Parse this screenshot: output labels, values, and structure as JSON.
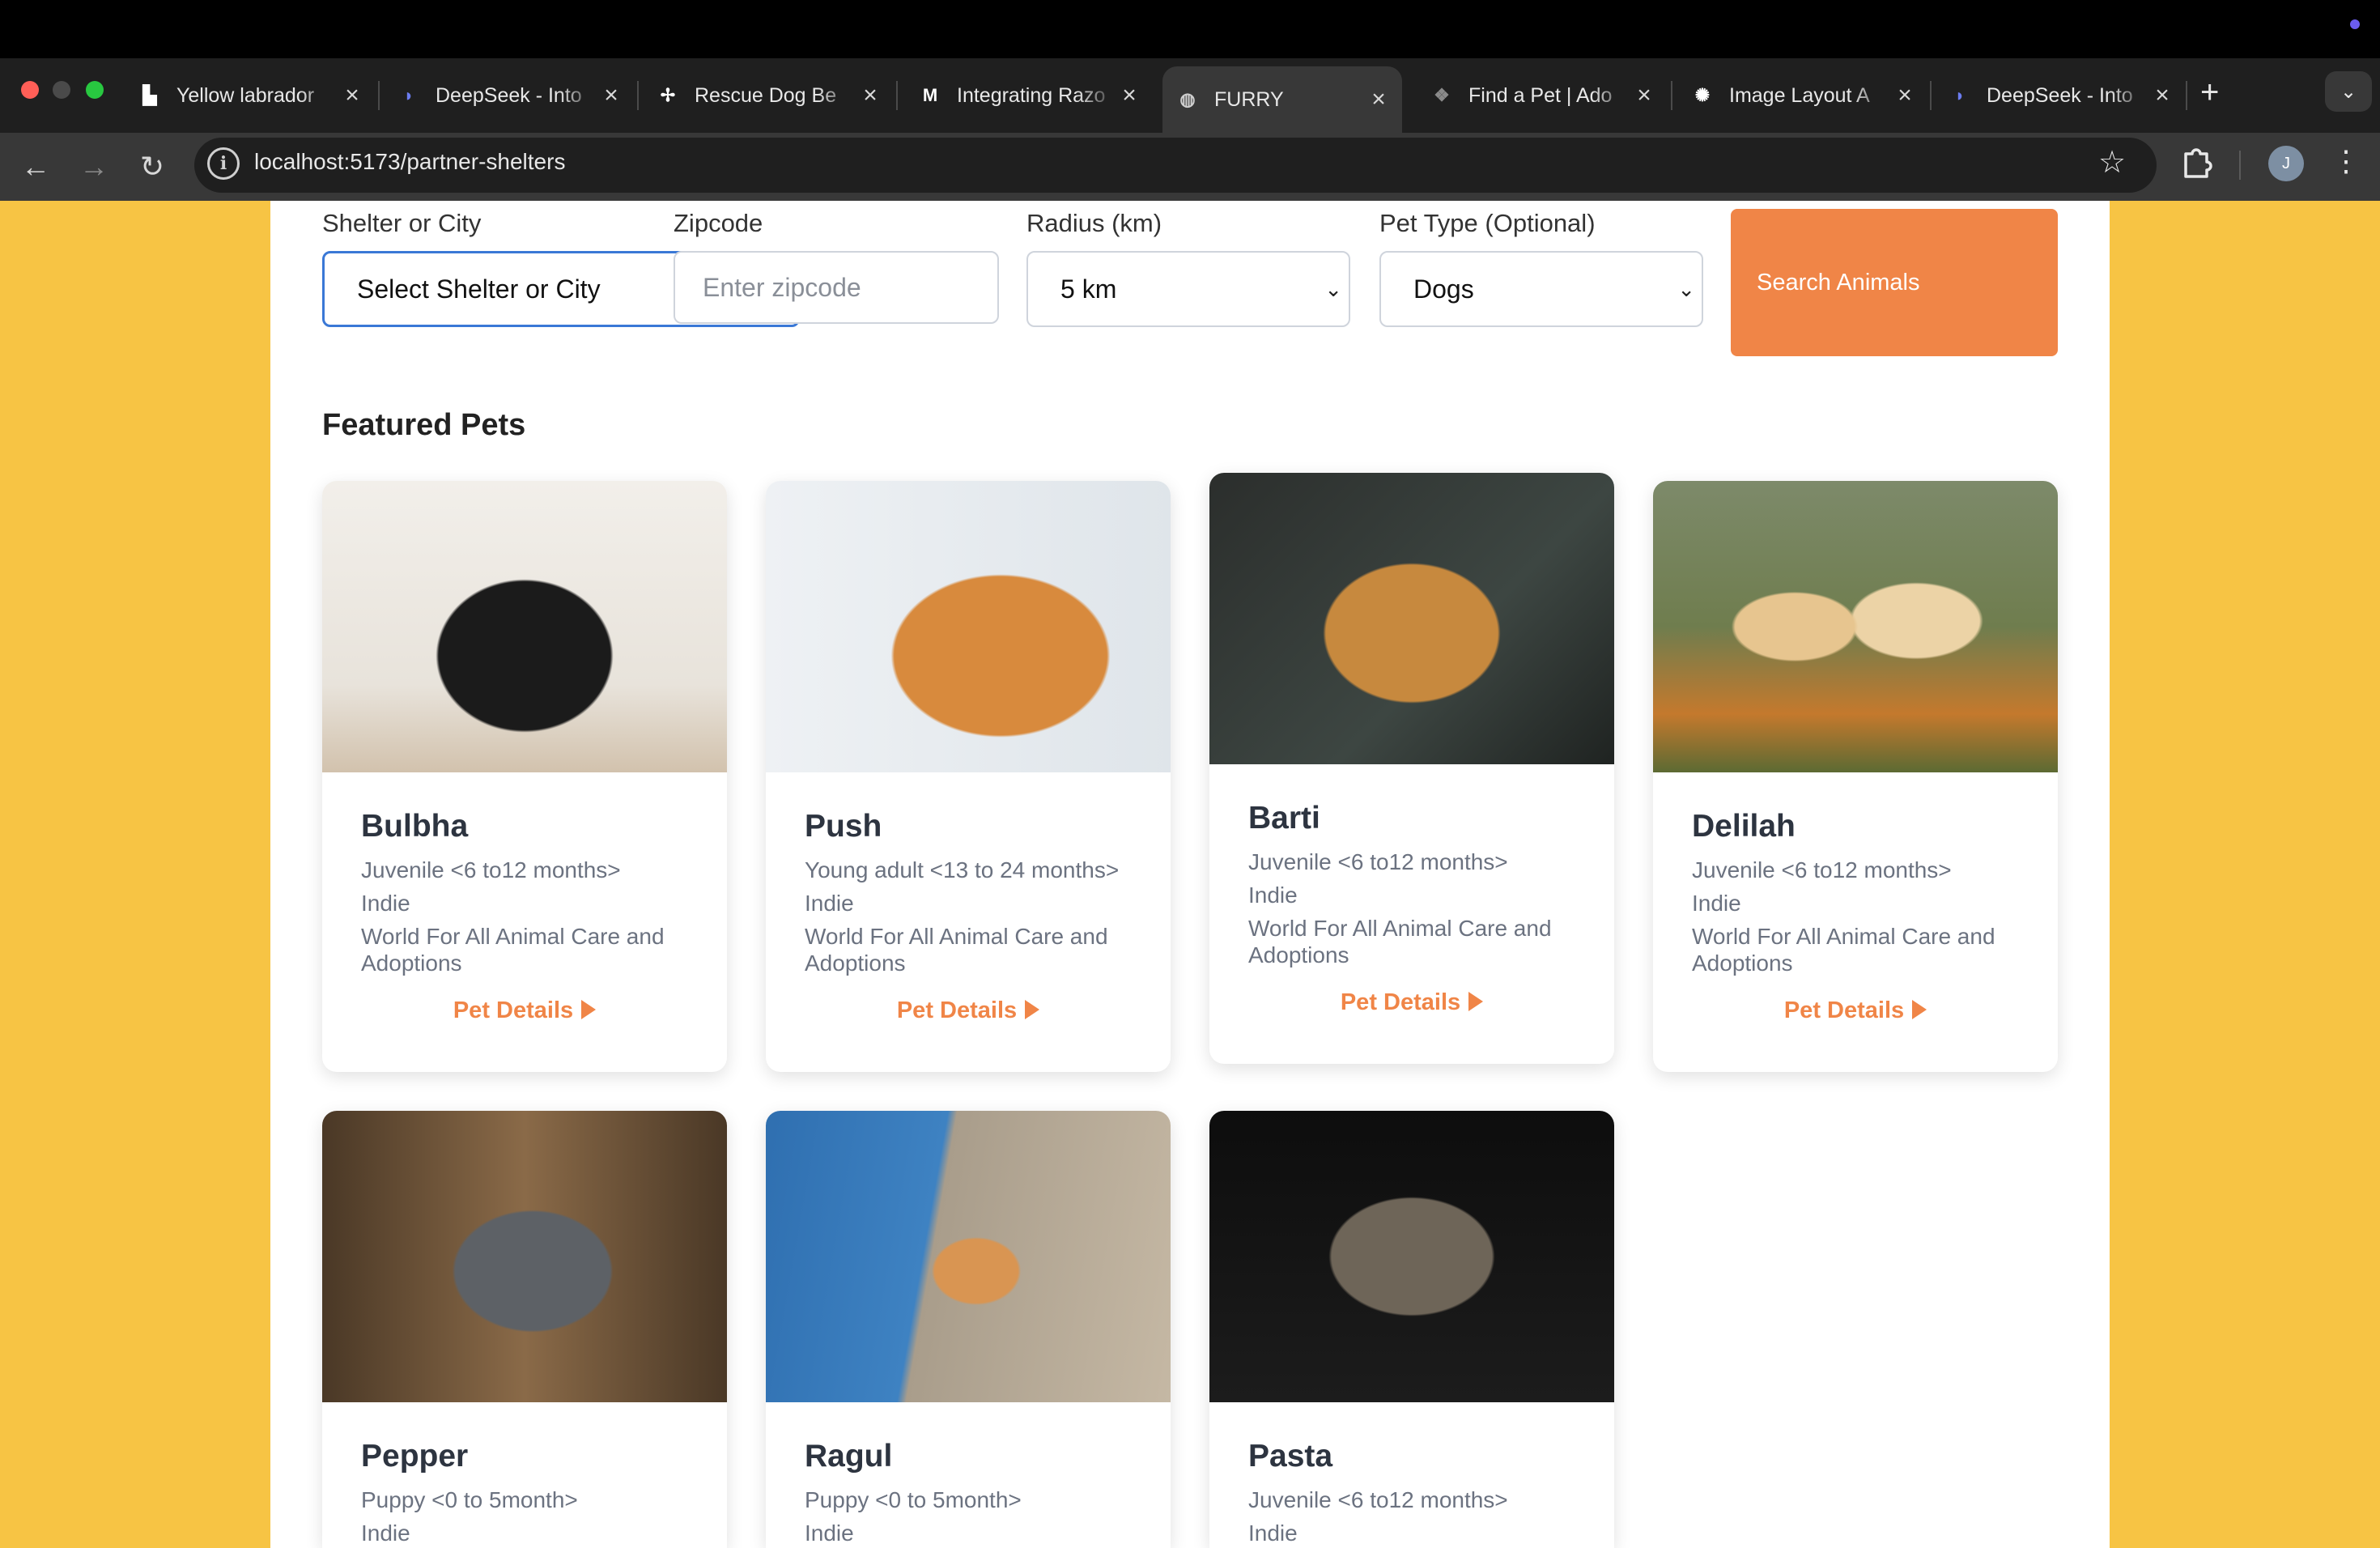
{
  "browser": {
    "tabs": [
      {
        "title": "Yellow labrador",
        "icon": "unsplash-icon"
      },
      {
        "title": "DeepSeek - Into",
        "icon": "deepseek-icon"
      },
      {
        "title": "Rescue Dog Be",
        "icon": "rescue-icon"
      },
      {
        "title": "Integrating Razo",
        "icon": "medium-icon"
      },
      {
        "title": "FURRY",
        "icon": "globe-icon",
        "active": true
      },
      {
        "title": "Find a Pet | Ado",
        "icon": "paw-icon"
      },
      {
        "title": "Image Layout A",
        "icon": "openai-icon"
      },
      {
        "title": "DeepSeek - Into",
        "icon": "deepseek-icon"
      }
    ],
    "url": "localhost:5173/partner-shelters",
    "profile_initial": "J"
  },
  "search": {
    "shelter_label": "Shelter or City",
    "shelter_value": "Select Shelter or City",
    "zipcode_label": "Zipcode",
    "zipcode_placeholder": "Enter zipcode",
    "radius_label": "Radius (km)",
    "radius_value": "5 km",
    "pettype_label": "Pet Type (Optional)",
    "pettype_value": "Dogs",
    "button_label": "Search Animals"
  },
  "featured": {
    "title": "Featured Pets",
    "details_label": "Pet Details",
    "pets": [
      {
        "name": "Bulbha",
        "age": "Juvenile <6 to12 months>",
        "breed": "Indie",
        "shelter": "World For All Animal Care and Adoptions"
      },
      {
        "name": "Push",
        "age": "Young adult <13 to 24 months>",
        "breed": "Indie",
        "shelter": "World For All Animal Care and Adoptions"
      },
      {
        "name": "Barti",
        "age": "Juvenile <6 to12 months>",
        "breed": "Indie",
        "shelter": "World For All Animal Care and Adoptions"
      },
      {
        "name": "Delilah",
        "age": "Juvenile <6 to12 months>",
        "breed": "Indie",
        "shelter": "World For All Animal Care and Adoptions"
      },
      {
        "name": "Pepper",
        "age": "Puppy <0 to 5month>",
        "breed": "Indie"
      },
      {
        "name": "Ragul",
        "age": "Puppy <0 to 5month>",
        "breed": "Indie"
      },
      {
        "name": "Pasta",
        "age": "Juvenile <6 to12 months>",
        "breed": "Indie"
      }
    ]
  },
  "colors": {
    "page_background": "#f7c444",
    "accent": "#f08547",
    "focus": "#3a78d6"
  }
}
